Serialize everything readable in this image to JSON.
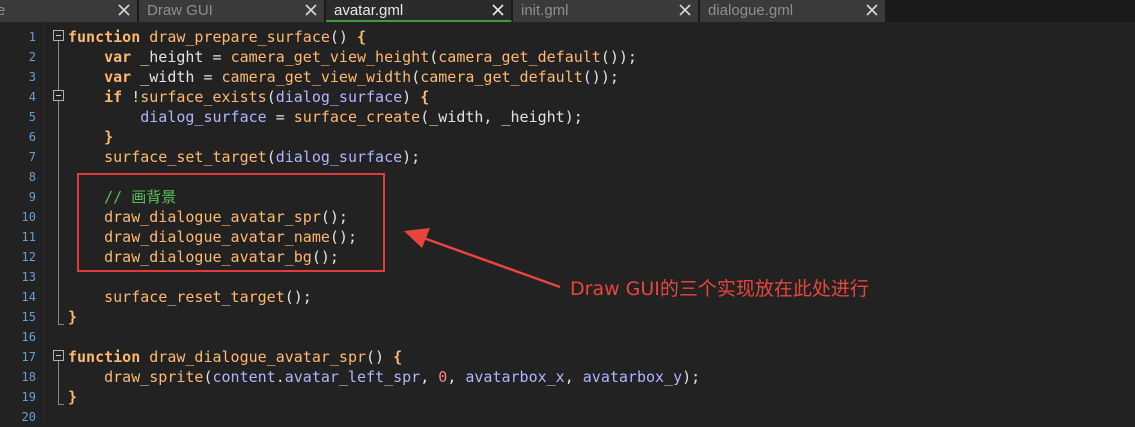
{
  "tabs": [
    {
      "label": "e",
      "active": false
    },
    {
      "label": "Draw GUI",
      "active": false
    },
    {
      "label": "avatar.gml",
      "active": true
    },
    {
      "label": "init.gml",
      "active": false
    },
    {
      "label": "dialogue.gml",
      "active": false
    }
  ],
  "line_numbers": [
    "1",
    "2",
    "3",
    "4",
    "5",
    "6",
    "7",
    "8",
    "9",
    "10",
    "11",
    "12",
    "13",
    "14",
    "15",
    "16",
    "17",
    "18",
    "19",
    "20"
  ],
  "code_lines": [
    [
      {
        "t": "kw",
        "v": "function"
      },
      {
        "t": "plain",
        "v": " "
      },
      {
        "t": "fn",
        "v": "draw_prepare_surface"
      },
      {
        "t": "plain",
        "v": "() "
      },
      {
        "t": "kw",
        "v": "{"
      }
    ],
    [
      {
        "t": "plain",
        "v": "    "
      },
      {
        "t": "kw",
        "v": "var"
      },
      {
        "t": "plain",
        "v": " _height = "
      },
      {
        "t": "fn",
        "v": "camera_get_view_height"
      },
      {
        "t": "plain",
        "v": "("
      },
      {
        "t": "fn",
        "v": "camera_get_default"
      },
      {
        "t": "plain",
        "v": "());"
      }
    ],
    [
      {
        "t": "plain",
        "v": "    "
      },
      {
        "t": "kw",
        "v": "var"
      },
      {
        "t": "plain",
        "v": " _width = "
      },
      {
        "t": "fn",
        "v": "camera_get_view_width"
      },
      {
        "t": "plain",
        "v": "("
      },
      {
        "t": "fn",
        "v": "camera_get_default"
      },
      {
        "t": "plain",
        "v": "());"
      }
    ],
    [
      {
        "t": "plain",
        "v": "    "
      },
      {
        "t": "kw",
        "v": "if"
      },
      {
        "t": "plain",
        "v": " !"
      },
      {
        "t": "fn",
        "v": "surface_exists"
      },
      {
        "t": "plain",
        "v": "("
      },
      {
        "t": "var",
        "v": "dialog_surface"
      },
      {
        "t": "plain",
        "v": ") "
      },
      {
        "t": "kw",
        "v": "{"
      }
    ],
    [
      {
        "t": "plain",
        "v": "        "
      },
      {
        "t": "var",
        "v": "dialog_surface"
      },
      {
        "t": "plain",
        "v": " = "
      },
      {
        "t": "fn",
        "v": "surface_create"
      },
      {
        "t": "plain",
        "v": "(_width, _height);"
      }
    ],
    [
      {
        "t": "plain",
        "v": "    "
      },
      {
        "t": "kw",
        "v": "}"
      }
    ],
    [
      {
        "t": "plain",
        "v": "    "
      },
      {
        "t": "fn",
        "v": "surface_set_target"
      },
      {
        "t": "plain",
        "v": "("
      },
      {
        "t": "var",
        "v": "dialog_surface"
      },
      {
        "t": "plain",
        "v": ");"
      }
    ],
    [],
    [
      {
        "t": "plain",
        "v": "    "
      },
      {
        "t": "cmt",
        "v": "// 画背景"
      }
    ],
    [
      {
        "t": "plain",
        "v": "    "
      },
      {
        "t": "fn",
        "v": "draw_dialogue_avatar_spr"
      },
      {
        "t": "plain",
        "v": "();"
      }
    ],
    [
      {
        "t": "plain",
        "v": "    "
      },
      {
        "t": "fn",
        "v": "draw_dialogue_avatar_name"
      },
      {
        "t": "plain",
        "v": "();"
      }
    ],
    [
      {
        "t": "plain",
        "v": "    "
      },
      {
        "t": "fn",
        "v": "draw_dialogue_avatar_bg"
      },
      {
        "t": "plain",
        "v": "();"
      }
    ],
    [],
    [
      {
        "t": "plain",
        "v": "    "
      },
      {
        "t": "fn",
        "v": "surface_reset_target"
      },
      {
        "t": "plain",
        "v": "();"
      }
    ],
    [
      {
        "t": "kw",
        "v": "}"
      }
    ],
    [],
    [
      {
        "t": "kw",
        "v": "function"
      },
      {
        "t": "plain",
        "v": " "
      },
      {
        "t": "fn",
        "v": "draw_dialogue_avatar_spr"
      },
      {
        "t": "plain",
        "v": "() "
      },
      {
        "t": "kw",
        "v": "{"
      }
    ],
    [
      {
        "t": "plain",
        "v": "    "
      },
      {
        "t": "fn",
        "v": "draw_sprite"
      },
      {
        "t": "plain",
        "v": "("
      },
      {
        "t": "var",
        "v": "content"
      },
      {
        "t": "plain",
        "v": "."
      },
      {
        "t": "var",
        "v": "avatar_left_spr"
      },
      {
        "t": "plain",
        "v": ", "
      },
      {
        "t": "num",
        "v": "0"
      },
      {
        "t": "plain",
        "v": ", "
      },
      {
        "t": "var",
        "v": "avatarbox_x"
      },
      {
        "t": "plain",
        "v": ", "
      },
      {
        "t": "var",
        "v": "avatarbox_y"
      },
      {
        "t": "plain",
        "v": ");"
      }
    ],
    [
      {
        "t": "kw",
        "v": "}"
      }
    ],
    []
  ],
  "annotation": {
    "text": "Draw GUI的三个实现放在此处进行",
    "color": "#e8453c"
  },
  "colors": {
    "keyword": "#ffb871",
    "variable": "#b0b5ff",
    "number": "#ff8080",
    "comment": "#5bbf5b",
    "line_number": "#6a9fd1",
    "active_tab_underline": "#3c9b3c"
  },
  "icons": {
    "tab_close": "close-icon",
    "fold": "fold-toggle-icon"
  }
}
